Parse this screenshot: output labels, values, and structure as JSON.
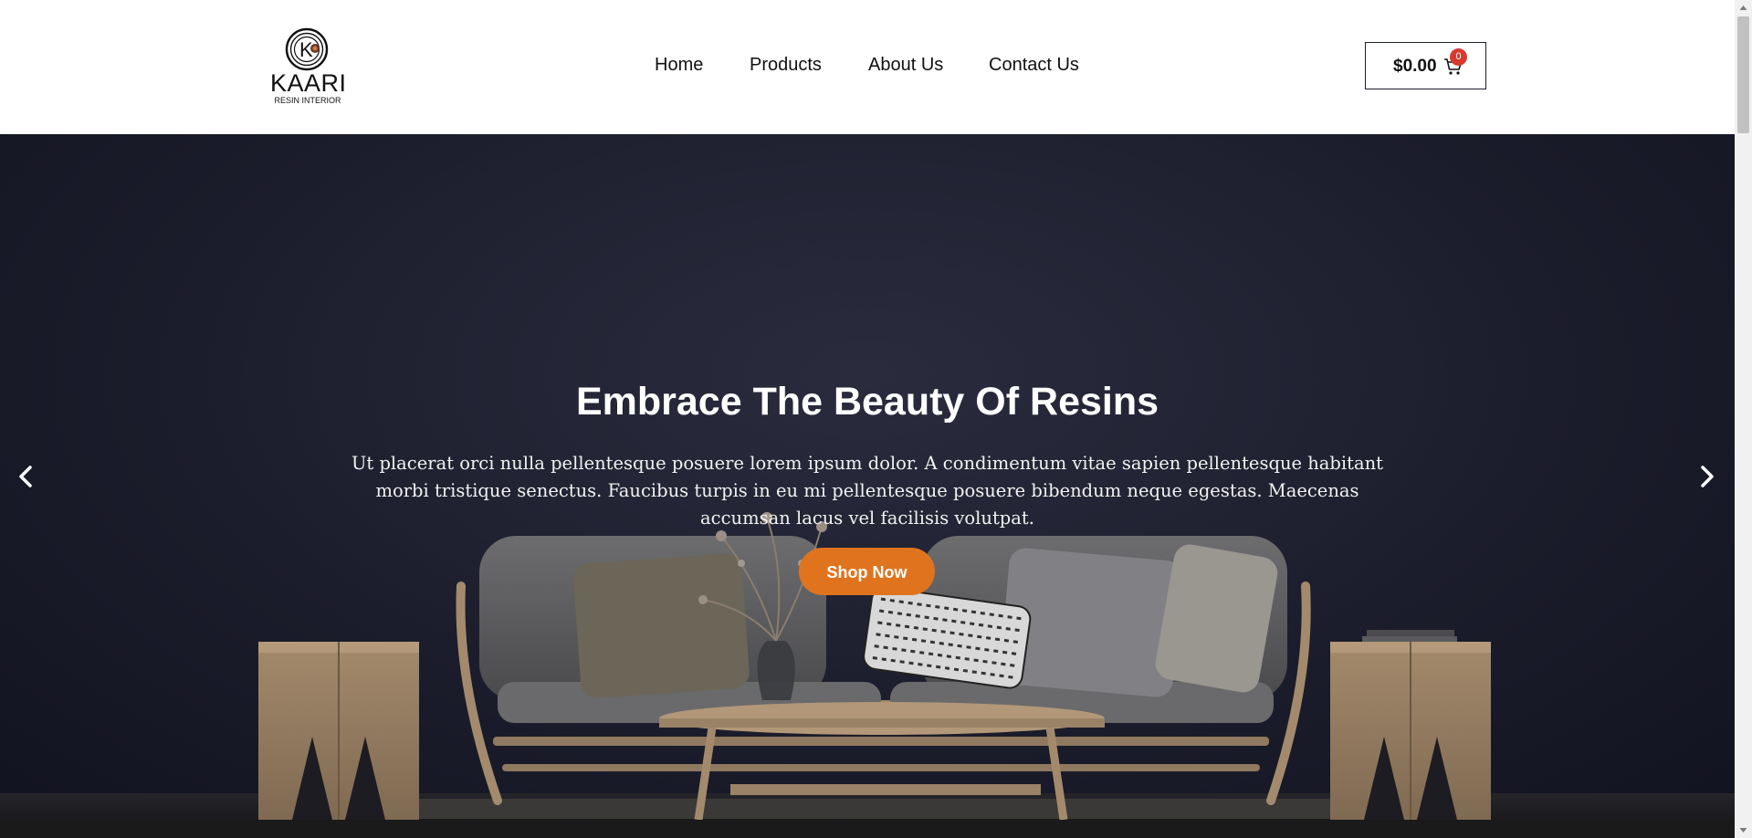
{
  "brand": {
    "name": "KAARI",
    "tagline": "RESIN INTERIOR",
    "logo_letter": "K"
  },
  "nav": {
    "items": [
      {
        "label": "Home"
      },
      {
        "label": "Products"
      },
      {
        "label": "About Us"
      },
      {
        "label": "Contact Us"
      }
    ]
  },
  "cart": {
    "amount": "$0.00",
    "count": "0",
    "icon": "cart-icon"
  },
  "hero": {
    "title": "Embrace The Beauty Of Resins",
    "text": "Ut placerat orci nulla pellentesque posuere lorem ipsum dolor. A condimentum vitae sapien pellentesque habitant morbi tristique senectus. Faucibus turpis in eu mi pellentesque posuere bibendum neque egestas. Maecenas accumsan lacus vel facilisis volutpat.",
    "button_label": "Shop Now",
    "prev_icon": "chevron-left-icon",
    "next_icon": "chevron-right-icon"
  },
  "colors": {
    "accent": "#e0741e",
    "badge": "#d63a2f",
    "hero_background": "#1c1d2c",
    "text_dark": "#111111"
  }
}
